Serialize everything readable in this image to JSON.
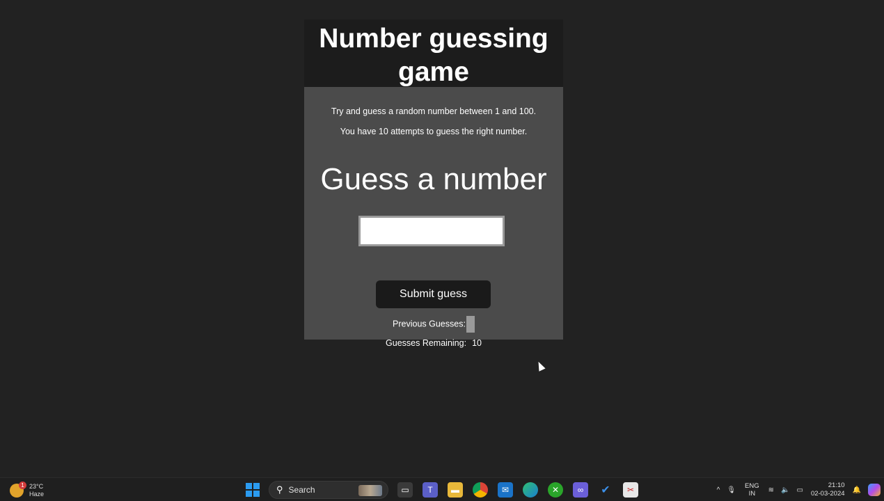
{
  "game": {
    "title": "Number guessing game",
    "intro_line_1": "Try and guess a random number between 1 and 100.",
    "intro_line_2": "You have 10 attempts to guess the right number.",
    "guess_label": "Guess a number",
    "guess_input_value": "",
    "submit_label": "Submit guess",
    "previous_guesses_label": "Previous Guesses:",
    "previous_guesses_value": "",
    "remaining_label": "Guesses Remaining:",
    "remaining_value": "10"
  },
  "taskbar": {
    "weather_temp": "23°C",
    "weather_desc": "Haze",
    "weather_badge": "1",
    "search_label": "Search",
    "lang_top": "ENG",
    "lang_bottom": "IN",
    "time": "21:10",
    "date": "02-03-2024",
    "icons": [
      "windows-start-icon",
      "search-icon",
      "task-view-icon",
      "teams-icon",
      "file-explorer-icon",
      "chrome-icon",
      "mail-icon",
      "edge-icon",
      "xbox-icon",
      "visual-studio-icon",
      "todo-icon",
      "snipping-tool-icon"
    ],
    "tray_icons": [
      "chevron-up-icon",
      "microphone-icon",
      "wifi-icon",
      "volume-icon",
      "battery-icon",
      "notification-bell-icon",
      "copilot-icon"
    ]
  },
  "colors": {
    "page_bg": "#222222",
    "panel_bg": "#4b4b4b",
    "header_bg": "#1c1c1c",
    "button_bg": "#1a1a1a",
    "accent_blue": "#2b9bf0"
  }
}
